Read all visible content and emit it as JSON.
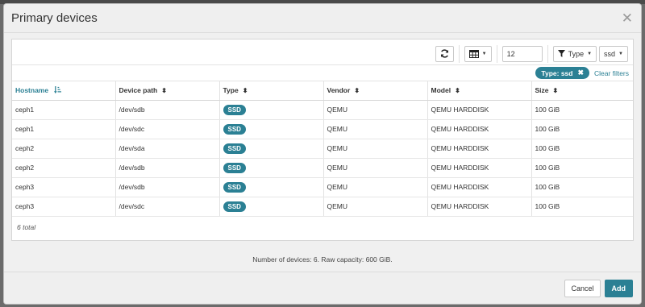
{
  "modal": {
    "title": "Primary devices"
  },
  "toolbar": {
    "limit_value": "12",
    "type_label": "Type",
    "type_value": "ssd"
  },
  "filters": {
    "active_badge": "Type: ssd",
    "clear_label": "Clear filters"
  },
  "table": {
    "columns": [
      "Hostname",
      "Device path",
      "Type",
      "Vendor",
      "Model",
      "Size"
    ],
    "rows": [
      [
        "ceph1",
        "/dev/sdb",
        "SSD",
        "QEMU",
        "QEMU HARDDISK",
        "100 GiB"
      ],
      [
        "ceph1",
        "/dev/sdc",
        "SSD",
        "QEMU",
        "QEMU HARDDISK",
        "100 GiB"
      ],
      [
        "ceph2",
        "/dev/sda",
        "SSD",
        "QEMU",
        "QEMU HARDDISK",
        "100 GiB"
      ],
      [
        "ceph2",
        "/dev/sdb",
        "SSD",
        "QEMU",
        "QEMU HARDDISK",
        "100 GiB"
      ],
      [
        "ceph3",
        "/dev/sdb",
        "SSD",
        "QEMU",
        "QEMU HARDDISK",
        "100 GiB"
      ],
      [
        "ceph3",
        "/dev/sdc",
        "SSD",
        "QEMU",
        "QEMU HARDDISK",
        "100 GiB"
      ]
    ],
    "total": "6 total"
  },
  "summary": "Number of devices: 6. Raw capacity: 600 GiB.",
  "footer": {
    "cancel_label": "Cancel",
    "add_label": "Add"
  },
  "colors": {
    "accent": "#2b8094"
  }
}
